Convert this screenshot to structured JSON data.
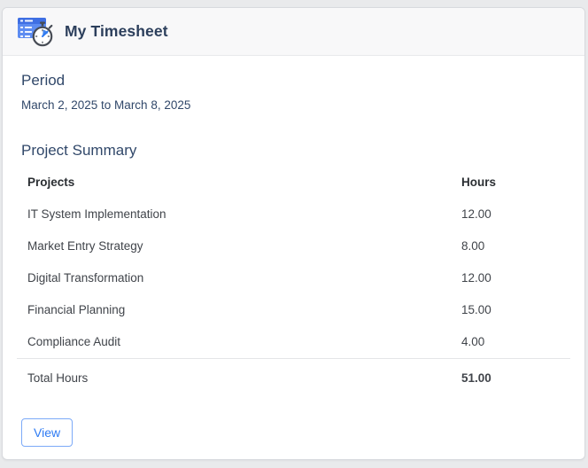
{
  "card": {
    "header": {
      "title": "My Timesheet",
      "icon": "timesheet-icon"
    },
    "period": {
      "heading": "Period",
      "range": "March 2, 2025 to March 8, 2025"
    },
    "summary": {
      "heading": "Project Summary",
      "table": {
        "columns": [
          "Projects",
          "Hours"
        ],
        "rows": [
          {
            "project": "IT System Implementation",
            "hours": "12.00"
          },
          {
            "project": "Market Entry Strategy",
            "hours": "8.00"
          },
          {
            "project": "Digital Transformation",
            "hours": "12.00"
          },
          {
            "project": "Financial Planning",
            "hours": "15.00"
          },
          {
            "project": "Compliance Audit",
            "hours": "4.00"
          }
        ],
        "total": {
          "label": "Total Hours",
          "value": "51.00"
        }
      }
    },
    "actions": {
      "view_label": "View"
    }
  },
  "colors": {
    "page_background": "#e9eaec",
    "card_background": "#ffffff",
    "header_background": "#f8f8f9",
    "title_navy": "#2c3f5c",
    "heading_navy": "#31486a",
    "accent_blue": "#2e7bf3",
    "icon_blue": "#5d8cf1",
    "separator": "#e4e5e7"
  }
}
